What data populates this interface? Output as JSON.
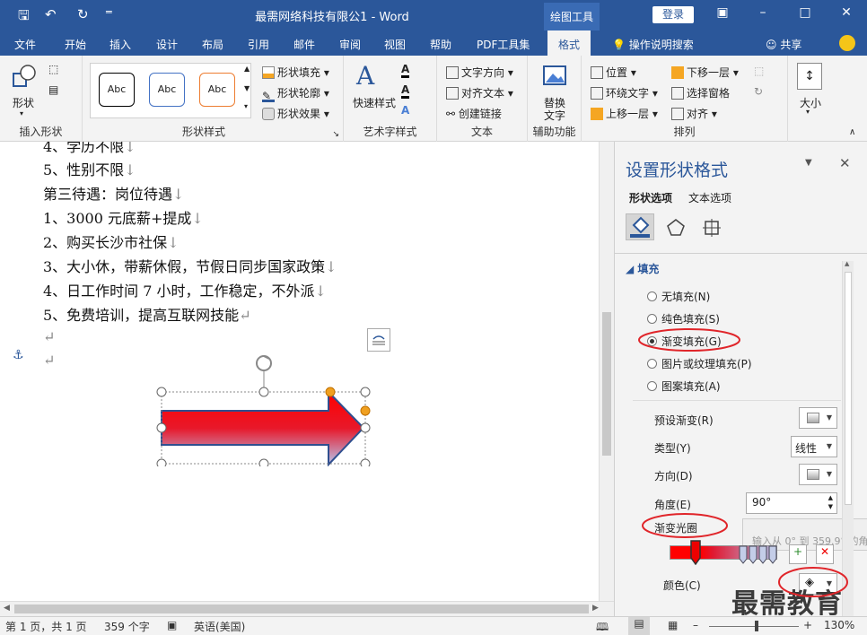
{
  "window": {
    "title": "最需网络科技有限公1 - Word",
    "context_tab": "绘图工具",
    "login": "登录"
  },
  "tabs": [
    "文件",
    "开始",
    "插入",
    "设计",
    "布局",
    "引用",
    "邮件",
    "审阅",
    "视图",
    "帮助",
    "PDF工具集",
    "格式"
  ],
  "tell_me": "操作说明搜索",
  "share": "共享",
  "ribbon": {
    "insert_shapes": {
      "shape_label": "形状",
      "group": "插入形状"
    },
    "shape_styles": {
      "style_sample": "Abc",
      "fill": "形状填充",
      "outline": "形状轮廓",
      "effects": "形状效果",
      "group": "形状样式"
    },
    "wordart": {
      "quick": "快速样式",
      "group": "艺术字样式"
    },
    "text": {
      "direction": "文字方向",
      "align": "对齐文本",
      "link": "创建链接",
      "group": "文本"
    },
    "accessibility": {
      "alt": "替换",
      "alt2": "文字",
      "group": "辅助功能"
    },
    "arrange": {
      "position": "位置",
      "wrap": "环绕文字",
      "forward": "上移一层",
      "backward": "下移一层",
      "selection": "选择窗格",
      "align": "对齐",
      "group": "排列"
    },
    "size": {
      "label": "大小"
    }
  },
  "document": {
    "lines": [
      "4、学历不限",
      "5、性别不限",
      "第三待遇：岗位待遇",
      "1、3000 元底薪+提成",
      "2、购买长沙市社保",
      "3、大小休，带薪休假，节假日同步国家政策",
      "4、日工作时间 7 小时，工作稳定，不外派",
      "5、免费培训，提高互联网技能"
    ],
    "para_mark": "↵",
    "line_mark": "↓"
  },
  "pane": {
    "title": "设置形状格式",
    "tab_shape": "形状选项",
    "tab_text": "文本选项",
    "section": "填充",
    "fill_options": [
      "无填充(N)",
      "纯色填充(S)",
      "渐变填充(G)",
      "图片或纹理填充(P)",
      "图案填充(A)"
    ],
    "selected_fill": 2,
    "preset": "预设渐变(R)",
    "type": "类型(Y)",
    "type_value": "线性",
    "direction": "方向(D)",
    "angle": "角度(E)",
    "angle_value": "90°",
    "stops": "渐变光圈",
    "tooltip": "输入从 0° 到 359.9° 的角",
    "color": "颜色(C)"
  },
  "watermark": "最需教育",
  "status": {
    "page": "第 1 页，共 1 页",
    "words": "359 个字",
    "lang": "英语(美国)",
    "zoom": "130%"
  },
  "colors": {
    "brand": "#2b579a",
    "annotation": "#e0252a",
    "arrow_start": "#ff0000",
    "arrow_end": "#b8c4ec"
  }
}
